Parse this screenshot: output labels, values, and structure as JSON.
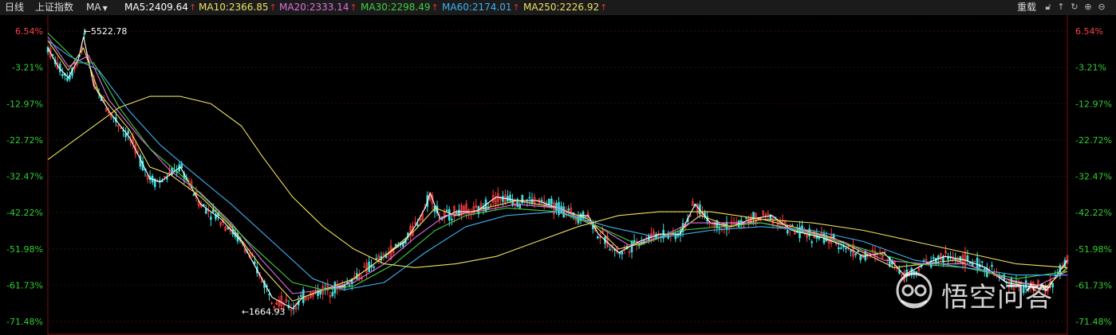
{
  "header": {
    "period": "日线",
    "index_name": "上证指数",
    "indicator": "MA",
    "ma": [
      {
        "label": "MA5:2409.64",
        "color": "#ffffff"
      },
      {
        "label": "MA10:2366.85",
        "color": "#f0e060"
      },
      {
        "label": "MA20:2333.14",
        "color": "#e070e0"
      },
      {
        "label": "MA30:2298.49",
        "color": "#40d040"
      },
      {
        "label": "MA60:2174.01",
        "color": "#40b0f0"
      },
      {
        "label": "MA250:2226.92",
        "color": "#f0e060"
      }
    ],
    "reset_label": "重载"
  },
  "toolbar_icons": [
    "lock-icon",
    "up-icon",
    "refresh-icon",
    "zoom-in-icon",
    "zoom-out-icon"
  ],
  "chart_data": {
    "type": "line",
    "y_tick_labels": [
      "6.54%",
      "-3.21%",
      "-12.97%",
      "-22.72%",
      "-32.47%",
      "-42.22%",
      "-51.98%",
      "-61.73%",
      "-71.48%"
    ],
    "y_ticks": [
      6.54,
      -3.21,
      -12.97,
      -22.72,
      -32.47,
      -42.22,
      -51.98,
      -61.73,
      -71.48
    ],
    "ylim": [
      -71.48,
      6.54
    ],
    "annotations": [
      {
        "label": "←5522.78",
        "x_frac": 0.035,
        "y": 6.5
      },
      {
        "label": "←1664.93",
        "x_frac": 0.19,
        "y": -68.8
      }
    ],
    "series": [
      {
        "name": "MA5",
        "color": "#ffffff",
        "points": [
          [
            0,
            2
          ],
          [
            0.01,
            -3
          ],
          [
            0.02,
            -6
          ],
          [
            0.03,
            -1
          ],
          [
            0.035,
            5
          ],
          [
            0.045,
            -8
          ],
          [
            0.06,
            -15
          ],
          [
            0.08,
            -22
          ],
          [
            0.1,
            -33
          ],
          [
            0.11,
            -34
          ],
          [
            0.13,
            -30
          ],
          [
            0.15,
            -40
          ],
          [
            0.17,
            -44
          ],
          [
            0.19,
            -50
          ],
          [
            0.21,
            -60
          ],
          [
            0.22,
            -65
          ],
          [
            0.24,
            -68
          ],
          [
            0.25,
            -65
          ],
          [
            0.27,
            -63
          ],
          [
            0.29,
            -62
          ],
          [
            0.31,
            -58
          ],
          [
            0.33,
            -54
          ],
          [
            0.35,
            -50
          ],
          [
            0.36,
            -46
          ],
          [
            0.37,
            -41
          ],
          [
            0.375,
            -37
          ],
          [
            0.385,
            -44
          ],
          [
            0.4,
            -42
          ],
          [
            0.42,
            -42
          ],
          [
            0.44,
            -38
          ],
          [
            0.46,
            -39
          ],
          [
            0.48,
            -39
          ],
          [
            0.5,
            -41
          ],
          [
            0.52,
            -43
          ],
          [
            0.53,
            -43
          ],
          [
            0.54,
            -48
          ],
          [
            0.56,
            -53
          ],
          [
            0.58,
            -50
          ],
          [
            0.6,
            -48
          ],
          [
            0.62,
            -48
          ],
          [
            0.635,
            -40
          ],
          [
            0.65,
            -45
          ],
          [
            0.67,
            -46
          ],
          [
            0.69,
            -44
          ],
          [
            0.71,
            -43
          ],
          [
            0.73,
            -47
          ],
          [
            0.76,
            -49
          ],
          [
            0.78,
            -51
          ],
          [
            0.8,
            -54
          ],
          [
            0.82,
            -53
          ],
          [
            0.84,
            -59
          ],
          [
            0.86,
            -56
          ],
          [
            0.88,
            -54
          ],
          [
            0.9,
            -55
          ],
          [
            0.92,
            -57
          ],
          [
            0.94,
            -61
          ],
          [
            0.96,
            -62
          ],
          [
            0.98,
            -63
          ],
          [
            1.0,
            -55
          ]
        ]
      },
      {
        "name": "MA10",
        "color": "#f0e060",
        "points": [
          [
            0,
            4
          ],
          [
            0.02,
            -4
          ],
          [
            0.035,
            2
          ],
          [
            0.05,
            -10
          ],
          [
            0.08,
            -20
          ],
          [
            0.1,
            -30
          ],
          [
            0.12,
            -32
          ],
          [
            0.15,
            -38
          ],
          [
            0.18,
            -46
          ],
          [
            0.21,
            -57
          ],
          [
            0.24,
            -66
          ],
          [
            0.27,
            -63
          ],
          [
            0.3,
            -60
          ],
          [
            0.33,
            -54
          ],
          [
            0.36,
            -47
          ],
          [
            0.38,
            -41
          ],
          [
            0.4,
            -43
          ],
          [
            0.43,
            -41
          ],
          [
            0.46,
            -39
          ],
          [
            0.5,
            -41
          ],
          [
            0.53,
            -44
          ],
          [
            0.56,
            -52
          ],
          [
            0.59,
            -50
          ],
          [
            0.62,
            -47
          ],
          [
            0.64,
            -43
          ],
          [
            0.67,
            -46
          ],
          [
            0.7,
            -44
          ],
          [
            0.73,
            -46
          ],
          [
            0.77,
            -49
          ],
          [
            0.8,
            -53
          ],
          [
            0.83,
            -57
          ],
          [
            0.86,
            -56
          ],
          [
            0.89,
            -55
          ],
          [
            0.92,
            -58
          ],
          [
            0.95,
            -61
          ],
          [
            0.98,
            -62
          ],
          [
            1.0,
            -57
          ]
        ]
      },
      {
        "name": "MA20",
        "color": "#e070e0",
        "points": [
          [
            0,
            5
          ],
          [
            0.02,
            -3
          ],
          [
            0.04,
            0
          ],
          [
            0.06,
            -12
          ],
          [
            0.09,
            -22
          ],
          [
            0.12,
            -31
          ],
          [
            0.15,
            -37
          ],
          [
            0.18,
            -45
          ],
          [
            0.21,
            -55
          ],
          [
            0.24,
            -64
          ],
          [
            0.27,
            -63
          ],
          [
            0.3,
            -61
          ],
          [
            0.33,
            -56
          ],
          [
            0.36,
            -49
          ],
          [
            0.39,
            -43
          ],
          [
            0.42,
            -42
          ],
          [
            0.46,
            -40
          ],
          [
            0.5,
            -41
          ],
          [
            0.54,
            -46
          ],
          [
            0.57,
            -51
          ],
          [
            0.6,
            -49
          ],
          [
            0.63,
            -45
          ],
          [
            0.66,
            -45
          ],
          [
            0.7,
            -45
          ],
          [
            0.74,
            -47
          ],
          [
            0.78,
            -50
          ],
          [
            0.82,
            -55
          ],
          [
            0.86,
            -56
          ],
          [
            0.9,
            -56
          ],
          [
            0.94,
            -60
          ],
          [
            0.97,
            -62
          ],
          [
            1.0,
            -58
          ]
        ]
      },
      {
        "name": "MA30",
        "color": "#40d040",
        "points": [
          [
            0,
            6
          ],
          [
            0.03,
            -2
          ],
          [
            0.045,
            -2
          ],
          [
            0.07,
            -14
          ],
          [
            0.1,
            -25
          ],
          [
            0.13,
            -32
          ],
          [
            0.16,
            -40
          ],
          [
            0.2,
            -51
          ],
          [
            0.24,
            -61
          ],
          [
            0.27,
            -63
          ],
          [
            0.3,
            -62
          ],
          [
            0.34,
            -56
          ],
          [
            0.38,
            -47
          ],
          [
            0.41,
            -43
          ],
          [
            0.45,
            -41
          ],
          [
            0.5,
            -42
          ],
          [
            0.54,
            -46
          ],
          [
            0.58,
            -51
          ],
          [
            0.62,
            -47
          ],
          [
            0.66,
            -46
          ],
          [
            0.7,
            -45
          ],
          [
            0.75,
            -48
          ],
          [
            0.8,
            -52
          ],
          [
            0.85,
            -56
          ],
          [
            0.9,
            -57
          ],
          [
            0.95,
            -60
          ],
          [
            1.0,
            -58
          ]
        ]
      },
      {
        "name": "MA60",
        "color": "#40b0f0",
        "points": [
          [
            0,
            4
          ],
          [
            0.02,
            0
          ],
          [
            0.05,
            -4
          ],
          [
            0.08,
            -15
          ],
          [
            0.11,
            -24
          ],
          [
            0.14,
            -31
          ],
          [
            0.18,
            -40
          ],
          [
            0.22,
            -50
          ],
          [
            0.26,
            -60
          ],
          [
            0.29,
            -63
          ],
          [
            0.33,
            -61
          ],
          [
            0.37,
            -53
          ],
          [
            0.41,
            -46
          ],
          [
            0.45,
            -43
          ],
          [
            0.5,
            -42
          ],
          [
            0.55,
            -46
          ],
          [
            0.6,
            -49
          ],
          [
            0.65,
            -47
          ],
          [
            0.7,
            -46
          ],
          [
            0.75,
            -47
          ],
          [
            0.8,
            -50
          ],
          [
            0.85,
            -55
          ],
          [
            0.9,
            -57
          ],
          [
            0.95,
            -59
          ],
          [
            1.0,
            -59
          ]
        ]
      },
      {
        "name": "MA250",
        "color": "#f0e060",
        "points": [
          [
            0,
            -28
          ],
          [
            0.04,
            -20
          ],
          [
            0.07,
            -14
          ],
          [
            0.1,
            -11
          ],
          [
            0.13,
            -11
          ],
          [
            0.16,
            -13
          ],
          [
            0.19,
            -19
          ],
          [
            0.21,
            -27
          ],
          [
            0.24,
            -38
          ],
          [
            0.27,
            -46
          ],
          [
            0.3,
            -52
          ],
          [
            0.33,
            -56
          ],
          [
            0.36,
            -57
          ],
          [
            0.4,
            -56
          ],
          [
            0.44,
            -54
          ],
          [
            0.48,
            -50
          ],
          [
            0.52,
            -46
          ],
          [
            0.56,
            -43
          ],
          [
            0.6,
            -42
          ],
          [
            0.65,
            -42
          ],
          [
            0.7,
            -44
          ],
          [
            0.75,
            -45
          ],
          [
            0.8,
            -47
          ],
          [
            0.85,
            -50
          ],
          [
            0.9,
            -53
          ],
          [
            0.95,
            -56
          ],
          [
            1.0,
            -57
          ]
        ]
      }
    ]
  },
  "watermark": {
    "text": "悟空问答"
  }
}
